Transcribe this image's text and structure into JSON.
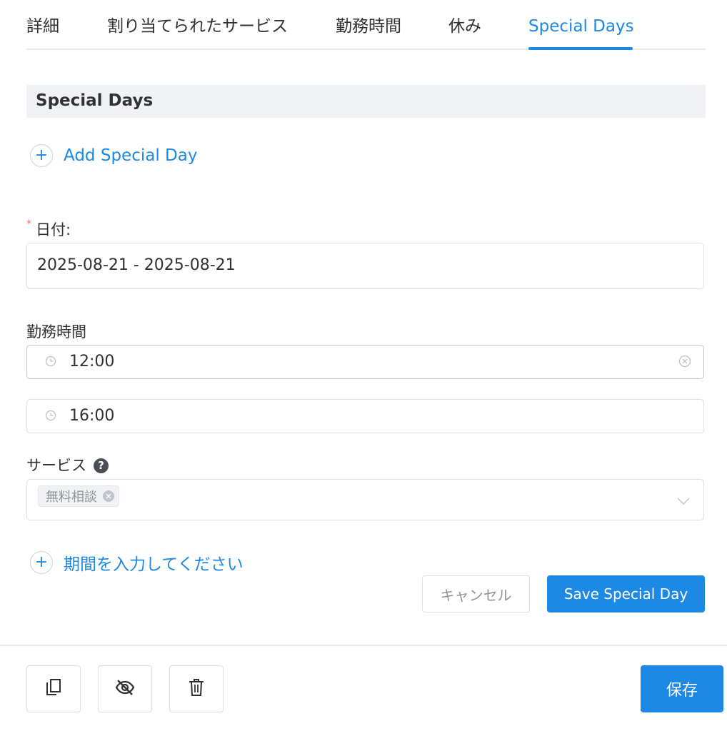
{
  "tabs": [
    {
      "label": "詳細"
    },
    {
      "label": "割り当てられたサービス"
    },
    {
      "label": "勤務時間"
    },
    {
      "label": "休み"
    },
    {
      "label": "Special Days",
      "active": true
    }
  ],
  "section": {
    "title": "Special Days"
  },
  "add_special_day": {
    "label": "Add Special Day",
    "icon": "plus-circle-icon"
  },
  "date_field": {
    "label": "日付:",
    "required_mark": "*",
    "value": "2025-08-21 - 2025-08-21"
  },
  "working_hours": {
    "label": "勤務時間",
    "start": {
      "value": "12:00",
      "icon": "clock-icon"
    },
    "end": {
      "value": "16:00",
      "icon": "clock-icon"
    }
  },
  "services": {
    "label": "サービス",
    "help_icon": "?",
    "selected_tags": [
      "無料相談"
    ]
  },
  "add_period": {
    "label": "期間を入力してください",
    "icon": "plus-circle-icon"
  },
  "buttons": {
    "cancel": "キャンセル",
    "save_special_day": "Save Special Day",
    "save": "保存"
  },
  "footer_actions": [
    "duplicate-icon",
    "hide-icon",
    "delete-icon"
  ],
  "colors": {
    "accent": "#1e88e5",
    "required": "#f56c6c",
    "section_bg": "#f1f2f5"
  }
}
